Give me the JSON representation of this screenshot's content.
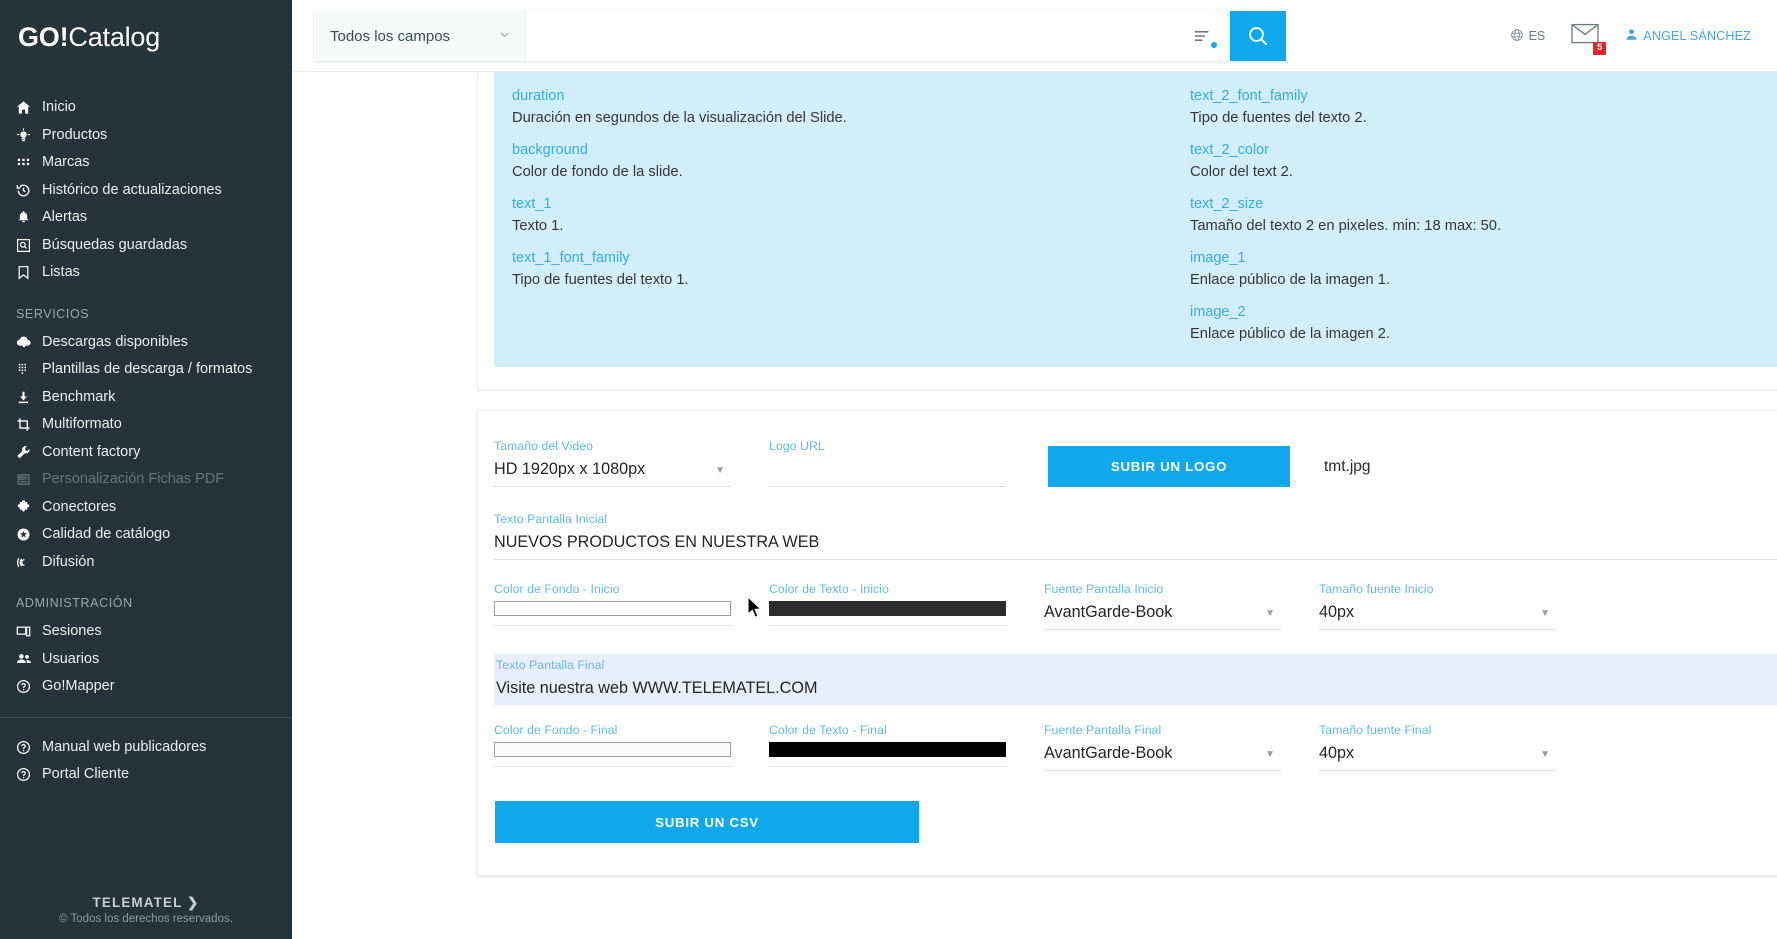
{
  "sidebar": {
    "brand_bold": "GO!",
    "brand_light": "Catalog",
    "main_items": [
      {
        "label": "Inicio",
        "icon": "home-icon"
      },
      {
        "label": "Productos",
        "icon": "product-icon"
      },
      {
        "label": "Marcas",
        "icon": "grid-icon"
      },
      {
        "label": "Histórico de actualizaciones",
        "icon": "history-icon"
      },
      {
        "label": "Alertas",
        "icon": "bell-icon"
      },
      {
        "label": "Búsquedas guardadas",
        "icon": "saved-search-icon"
      },
      {
        "label": "Listas",
        "icon": "bookmark-icon"
      }
    ],
    "services_title": "SERVICIOS",
    "services_items": [
      {
        "label": "Descargas disponibles",
        "icon": "cloud-download-icon"
      },
      {
        "label": "Plantillas de descarga / formatos",
        "icon": "template-grid-icon"
      },
      {
        "label": "Benchmark",
        "icon": "download-icon"
      },
      {
        "label": "Multiformato",
        "icon": "crop-icon"
      },
      {
        "label": "Content factory",
        "icon": "wrench-icon"
      },
      {
        "label": "Personalización Fichas PDF",
        "icon": "pdf-sheet-icon",
        "disabled": true
      },
      {
        "label": "Conectores",
        "icon": "puzzle-icon"
      },
      {
        "label": "Calidad de catálogo",
        "icon": "star-circle-icon"
      },
      {
        "label": "Difusión",
        "icon": "rss-icon"
      }
    ],
    "admin_title": "ADMINISTRACIÓN",
    "admin_items": [
      {
        "label": "Sesiones",
        "icon": "session-screen-icon"
      },
      {
        "label": "Usuarios",
        "icon": "users-icon"
      },
      {
        "label": "Go!Mapper",
        "icon": "question-circle-icon"
      }
    ],
    "bottom_items": [
      {
        "label": "Manual web publicadores",
        "icon": "question-circle-icon"
      },
      {
        "label": "Portal Cliente",
        "icon": "question-circle-icon"
      }
    ],
    "footer_brand": "TELEMATEL ❯",
    "footer_copyright": "© Todos los derechos reservados."
  },
  "header": {
    "search_scope": "Todos los campos",
    "search_value": "",
    "search_placeholder": "",
    "language": "ES",
    "mail_badge": "5",
    "user_name": "ANGEL SÁNCHEZ"
  },
  "info_panel": {
    "left": [
      {
        "key": "duration",
        "value": "Duración en segundos de la visualización del Slide."
      },
      {
        "key": "background",
        "value": "Color de fondo de la slide."
      },
      {
        "key": "text_1",
        "value": "Texto 1."
      },
      {
        "key": "text_1_font_family",
        "value": "Tipo de fuentes del texto 1."
      }
    ],
    "right": [
      {
        "key": "text_2_font_family",
        "value": "Tipo de fuentes del texto 2."
      },
      {
        "key": "text_2_color",
        "value": "Color del text 2."
      },
      {
        "key": "text_2_size",
        "value": "Tamaño del texto 2 en pixeles. min: 18 max: 50."
      },
      {
        "key": "image_1",
        "value": "Enlace público de la imagen 1."
      },
      {
        "key": "image_2",
        "value": "Enlace público de la imagen 2."
      }
    ]
  },
  "form": {
    "video_size_label": "Tamaño del Video",
    "video_size_value": "HD 1920px x 1080px",
    "logo_url_label": "Logo URL",
    "logo_url_value": "",
    "upload_logo_button": "SUBIR UN LOGO",
    "logo_filename": "tmt.jpg",
    "remove_logo_button": "×",
    "start_text_label": "Texto Pantalla Inicial",
    "start_text_value": "NUEVOS PRODUCTOS EN NUESTRA WEB",
    "start_bg_color_label": "Color de Fondo - Inicio",
    "start_bg_color_value": "#ffffff",
    "start_text_color_label": "Color de Texto - Inicio",
    "start_text_color_value": "#2d2d2d",
    "start_font_label": "Fuente Pantalla Inicio",
    "start_font_value": "AvantGarde-Book",
    "start_font_size_label": "Tamaño fuente Inicio",
    "start_font_size_value": "40px",
    "final_text_label": "Texto Pantalla Final",
    "final_text_value": "Visite nuestra web WWW.TELEMATEL.COM",
    "final_bg_color_label": "Color de Fondo - Final",
    "final_bg_color_value": "#ffffff",
    "final_text_color_label": "Color de Texto - Final",
    "final_text_color_value": "#000000",
    "final_font_label": "Fuente Pantalla Final",
    "final_font_value": "AvantGarde-Book",
    "final_font_size_label": "Tamaño fuente Final",
    "final_font_size_value": "40px",
    "upload_csv_button": "SUBIR UN CSV"
  },
  "theme": {
    "accent_blue": "#0fa8ec",
    "sidebar_bg": "#26333b",
    "info_panel_bg": "#d3eefb",
    "label_blue": "#63b9e6",
    "badge_red": "#e8202a"
  }
}
